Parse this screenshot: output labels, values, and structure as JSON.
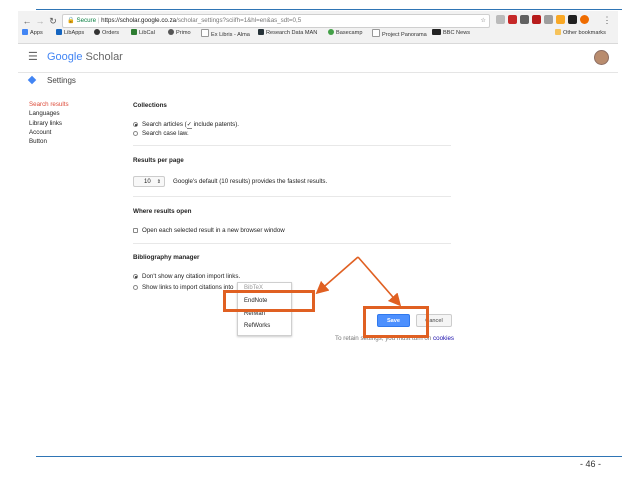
{
  "browser": {
    "secure_label": "Secure",
    "url_host": "https://scholar.google.co.za",
    "url_path": "/scholar_settings?sciifh=1&hl=en&as_sdt=0,5",
    "bookmarks": [
      "Apps",
      "LibApps",
      "Orders",
      "LibCal",
      "Primo",
      "Ex Libris - Alma",
      "Research Data MAN",
      "Basecamp",
      "Project Panorama",
      "BBC News"
    ],
    "other_bookmarks": "Other bookmarks"
  },
  "header": {
    "logo_google": "Google",
    "logo_scholar": "Scholar",
    "page_title": "Settings"
  },
  "left_nav": {
    "items": [
      "Search results",
      "Languages",
      "Library links",
      "Account",
      "Button"
    ]
  },
  "collections": {
    "title": "Collections",
    "options": [
      "Search articles (",
      " include patents).",
      "Search case law."
    ]
  },
  "results_per_page": {
    "title": "Results per page",
    "value": "10",
    "hint": "Google's default (10 results) provides the fastest results."
  },
  "where_results_open": {
    "title": "Where results open",
    "option": "Open each selected result in a new browser window"
  },
  "bibliography": {
    "title": "Bibliography manager",
    "option_dont_show": "Don't show any citation import links.",
    "option_show": "Show links to import citations into",
    "dropdown_options": [
      "BibTeX",
      "EndNote",
      "RefMan",
      "RefWorks"
    ]
  },
  "buttons": {
    "save": "Save",
    "cancel": "Cancel"
  },
  "footer": {
    "retain_text": "To retain settings, you must turn on",
    "cookies_link": "cookies"
  },
  "slide": {
    "page_number": "- 46 -"
  },
  "colors": {
    "annotation": "#e06022",
    "accent_blue": "#4d90fe",
    "nav_red": "#dd4b39",
    "slide_line": "#2f75b5"
  }
}
